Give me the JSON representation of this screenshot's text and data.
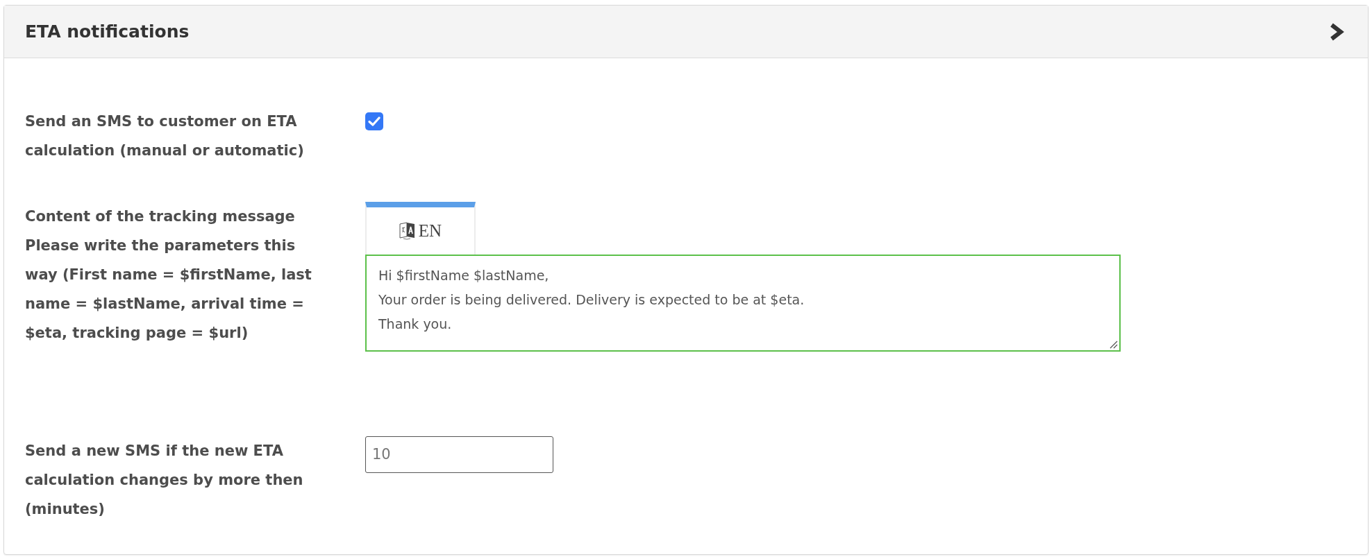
{
  "panel": {
    "title": "ETA notifications"
  },
  "fields": [
    {
      "kind": "checkbox",
      "label": "Send an SMS to customer on ETA calculation (manual or automatic)",
      "checked": true
    },
    {
      "kind": "message",
      "label": "Content of the tracking message",
      "hint": "Please write the parameters this way (First name = $firstName, last name = $lastName, arrival time = $eta, tracking page = $url)",
      "tabs": [
        {
          "label": "EN",
          "selected": true
        }
      ],
      "value": "Hi $firstName $lastName,\nYour order is being delivered. Delivery is expected to be at $eta.\nThank you."
    },
    {
      "kind": "number",
      "label": "Send a new SMS if the new ETA calculation changes by more then (minutes)",
      "value": "10"
    }
  ]
}
